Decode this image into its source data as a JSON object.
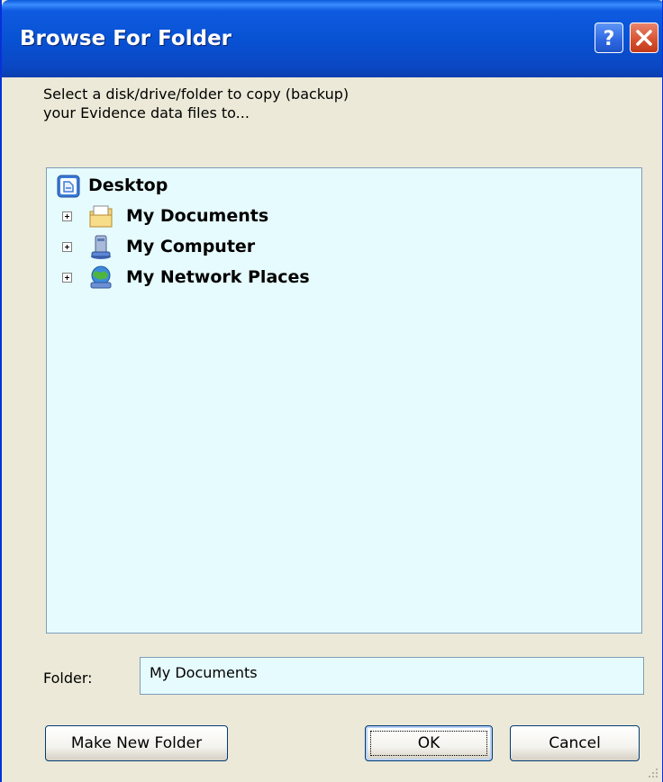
{
  "window": {
    "title": "Browse For Folder",
    "help_symbol": "?",
    "close_symbol": "X"
  },
  "description": {
    "line1": "Select a disk/drive/folder to copy (backup)",
    "line2": "your Evidence data files to..."
  },
  "tree": {
    "items": [
      {
        "label": "Desktop",
        "icon": "desktop-icon",
        "level": 0,
        "expandable": false,
        "selected": false
      },
      {
        "label": "My Documents",
        "icon": "my-documents-icon",
        "level": 1,
        "expandable": true,
        "selected": true
      },
      {
        "label": "My Computer",
        "icon": "my-computer-icon",
        "level": 1,
        "expandable": true,
        "selected": false
      },
      {
        "label": "My Network Places",
        "icon": "network-places-icon",
        "level": 1,
        "expandable": true,
        "selected": false
      }
    ]
  },
  "folder": {
    "label": "Folder:",
    "value": "My Documents"
  },
  "buttons": {
    "make_new_folder": "Make New Folder",
    "ok": "OK",
    "cancel": "Cancel"
  },
  "colors": {
    "titlebar": "#0852d4",
    "tree_background": "#e6fbfd",
    "dialog_background": "#ece9d8",
    "selection": "#ece8d6"
  }
}
